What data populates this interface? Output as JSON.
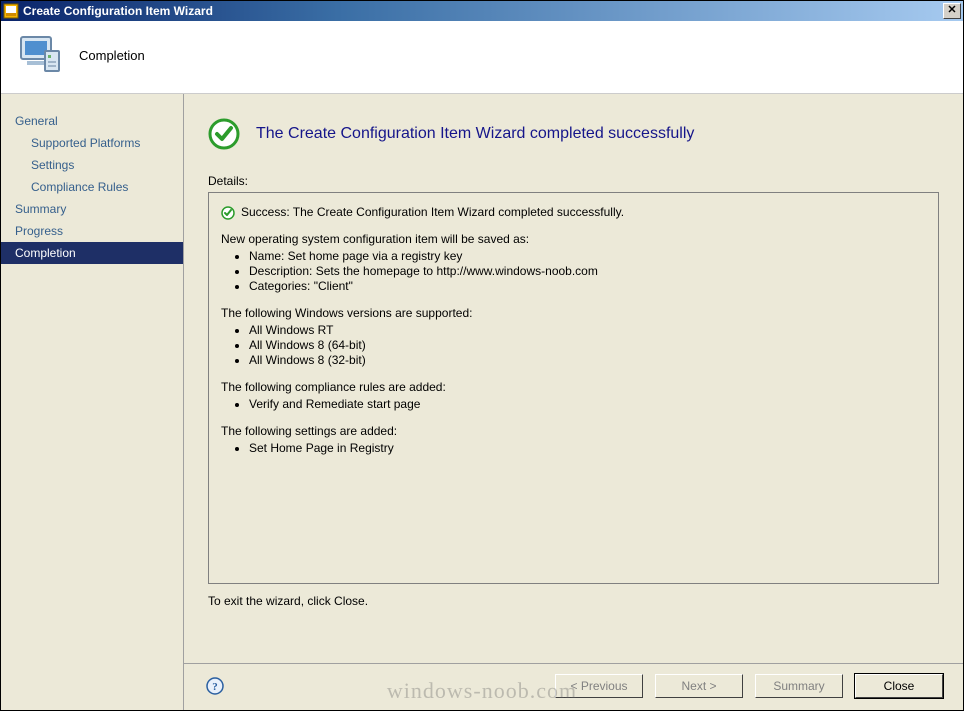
{
  "titlebar": {
    "title": "Create Configuration Item Wizard"
  },
  "header": {
    "stage": "Completion"
  },
  "sidebar": {
    "items": [
      {
        "label": "General",
        "sub": false,
        "selected": false
      },
      {
        "label": "Supported Platforms",
        "sub": true,
        "selected": false
      },
      {
        "label": "Settings",
        "sub": true,
        "selected": false
      },
      {
        "label": "Compliance Rules",
        "sub": true,
        "selected": false
      },
      {
        "label": "Summary",
        "sub": false,
        "selected": false
      },
      {
        "label": "Progress",
        "sub": false,
        "selected": false
      },
      {
        "label": "Completion",
        "sub": false,
        "selected": true
      }
    ]
  },
  "main": {
    "heading": "The Create Configuration Item Wizard completed successfully",
    "details_label": "Details:",
    "status_line": "Success: The Create Configuration Item Wizard completed successfully.",
    "save_intro": "New operating system configuration item will be saved as:",
    "save_items": [
      "Name: Set home page via a registry key",
      "Description: Sets the homepage to http://www.windows-noob.com",
      "Categories: \"Client\""
    ],
    "versions_intro": "The following Windows versions are supported:",
    "versions_items": [
      "All Windows RT",
      "All Windows 8 (64-bit)",
      "All Windows 8 (32-bit)"
    ],
    "rules_intro": "The following compliance rules are added:",
    "rules_items": [
      "Verify and Remediate start page"
    ],
    "settings_intro": "The following settings are added:",
    "settings_items": [
      "Set Home Page in Registry"
    ],
    "exit_text": "To exit the wizard, click Close."
  },
  "buttons": {
    "previous": "< Previous",
    "next": "Next >",
    "summary": "Summary",
    "close": "Close"
  },
  "watermark": "windows-noob.com"
}
